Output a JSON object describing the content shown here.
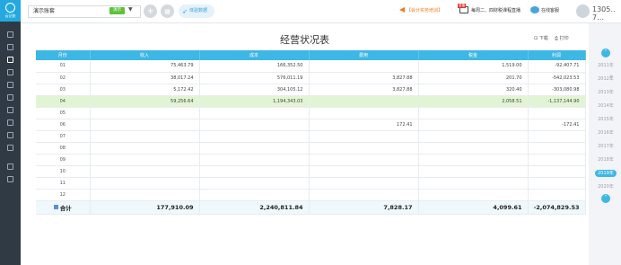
{
  "sidebar": {
    "logo_text": "云记账",
    "icons": [
      "dashboard-icon",
      "voucher-icon",
      "report-icon",
      "ledger-icon",
      "account-icon",
      "invoice-icon",
      "asset-icon",
      "print-icon",
      "archive-icon",
      "settings-icon",
      "calculator-icon",
      "link-icon"
    ]
  },
  "topbar": {
    "account_name": "演示账套",
    "account_badge": "演示",
    "add_label": "+",
    "exp_label": "体验数据",
    "promo_text": "【会计实务培训】",
    "live_badge": "直播",
    "live_text": "每周二、四财税课程直播",
    "service_text": "在线客服",
    "user_name": "1305‥7…"
  },
  "report": {
    "title": "经营状况表",
    "download_label": "下载",
    "print_label": "打印"
  },
  "table": {
    "headers": [
      "月份",
      "收入",
      "成本",
      "费用",
      "税金",
      "利润"
    ],
    "rows": [
      {
        "month": "01",
        "income": "75,463.79",
        "cost": "166,352.50",
        "expense": "",
        "tax": "1,519.00",
        "profit": "-92,407.71",
        "highlight": false
      },
      {
        "month": "02",
        "income": "38,017.24",
        "cost": "576,011.19",
        "expense": "3,827.88",
        "tax": "201.70",
        "profit": "-542,023.53",
        "highlight": false
      },
      {
        "month": "03",
        "income": "5,172.42",
        "cost": "304,105.12",
        "expense": "3,827.88",
        "tax": "320.40",
        "profit": "-303,080.98",
        "highlight": false
      },
      {
        "month": "04",
        "income": "59,256.64",
        "cost": "1,194,343.03",
        "expense": "",
        "tax": "2,058.51",
        "profit": "-1,137,144.90",
        "highlight": true
      },
      {
        "month": "05",
        "income": "",
        "cost": "",
        "expense": "",
        "tax": "",
        "profit": "",
        "highlight": false
      },
      {
        "month": "06",
        "income": "",
        "cost": "",
        "expense": "172.41",
        "tax": "",
        "profit": "-172.41",
        "highlight": false
      },
      {
        "month": "07",
        "income": "",
        "cost": "",
        "expense": "",
        "tax": "",
        "profit": "",
        "highlight": false
      },
      {
        "month": "08",
        "income": "",
        "cost": "",
        "expense": "",
        "tax": "",
        "profit": "",
        "highlight": false
      },
      {
        "month": "09",
        "income": "",
        "cost": "",
        "expense": "",
        "tax": "",
        "profit": "",
        "highlight": false
      },
      {
        "month": "10",
        "income": "",
        "cost": "",
        "expense": "",
        "tax": "",
        "profit": "",
        "highlight": false
      },
      {
        "month": "11",
        "income": "",
        "cost": "",
        "expense": "",
        "tax": "",
        "profit": "",
        "highlight": false
      },
      {
        "month": "12",
        "income": "",
        "cost": "",
        "expense": "",
        "tax": "",
        "profit": "",
        "highlight": false
      }
    ],
    "total": {
      "label": "合计",
      "income": "177,910.09",
      "cost": "2,240,811.84",
      "expense": "7,828.17",
      "tax": "4,099.61",
      "profit": "-2,074,829.53"
    }
  },
  "years": {
    "items": [
      "2011年",
      "2012年",
      "2013年",
      "2014年",
      "2015年",
      "2016年",
      "2017年",
      "2018年",
      "2019年",
      "2020年"
    ],
    "active": "2019年"
  },
  "colors": {
    "accent": "#3db7e5",
    "sidebar": "#2f3a45",
    "highlight_row": "#e1f5d4",
    "promo": "#f07c1e"
  }
}
